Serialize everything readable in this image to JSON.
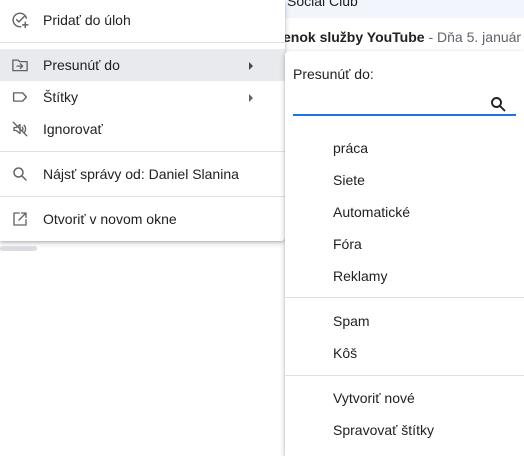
{
  "background": {
    "row1_text": "Social Club",
    "row2_subject": "enok služby YouTube",
    "row2_separator": " - ",
    "row2_snippet": "Dňa 5. január"
  },
  "context_menu": {
    "items": [
      {
        "label": "Pridať do úloh",
        "icon": "add-task-icon"
      },
      {
        "label": "Presunúť do",
        "icon": "move-to-icon",
        "has_submenu": true,
        "active": true
      },
      {
        "label": "Štítky",
        "icon": "label-icon",
        "has_submenu": true
      },
      {
        "label": "Ignorovať",
        "icon": "mute-icon"
      },
      {
        "label": "Nájsť správy od: Daniel Slanina",
        "icon": "search-icon"
      },
      {
        "label": "Otvoriť v novom okne",
        "icon": "open-in-new-icon"
      }
    ]
  },
  "move_to_submenu": {
    "heading": "Presunúť do:",
    "search_value": "",
    "search_placeholder": "",
    "labels": [
      "práca",
      "Siete",
      "Automatické",
      "Fóra",
      "Reklamy"
    ],
    "system": [
      "Spam",
      "Kôš"
    ],
    "actions": [
      "Vytvoriť nové",
      "Spravovať štítky"
    ]
  },
  "colors": {
    "accent": "#1a73e8",
    "active_item_bg": "#e8eaed",
    "icon": "#5f6368",
    "text": "#202124"
  }
}
